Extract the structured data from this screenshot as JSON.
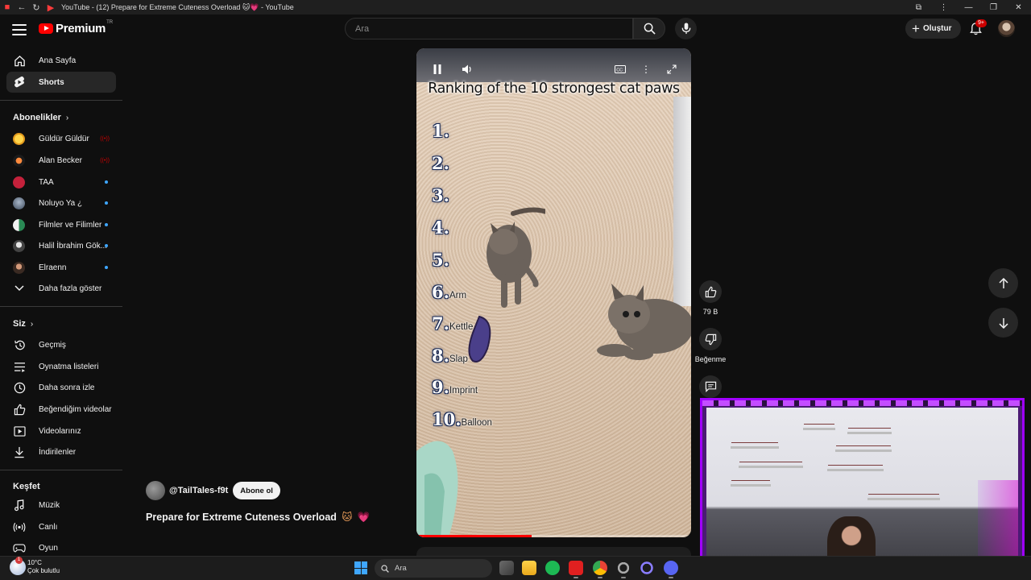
{
  "window": {
    "title": "YouTube - (12) Prepare for Extreme Cuteness Overload 🐱💗 - YouTube"
  },
  "masthead": {
    "logo_word": "Premium",
    "logo_sup": "TR",
    "search_placeholder": "Ara",
    "create_label": "Oluştur",
    "notification_count": "9+"
  },
  "sidebar": {
    "main": [
      {
        "label": "Ana Sayfa",
        "icon": "home-icon"
      },
      {
        "label": "Shorts",
        "icon": "shorts-icon",
        "active": true
      }
    ],
    "subscriptions_title": "Abonelikler",
    "subscriptions": [
      {
        "label": "Güldür Güldür",
        "indicator": "live"
      },
      {
        "label": "Alan Becker",
        "indicator": "live"
      },
      {
        "label": "TAA",
        "indicator": "new"
      },
      {
        "label": "Noluyo Ya ¿",
        "indicator": "new"
      },
      {
        "label": "Filmler ve Filimler",
        "indicator": "new"
      },
      {
        "label": "Halil İbrahim Gök...",
        "indicator": "new"
      },
      {
        "label": "Elraenn",
        "indicator": "new"
      }
    ],
    "show_more": "Daha fazla göster",
    "you_title": "Siz",
    "you_items": [
      {
        "label": "Geçmiş",
        "icon": "history-icon"
      },
      {
        "label": "Oynatma listeleri",
        "icon": "playlists-icon"
      },
      {
        "label": "Daha sonra izle",
        "icon": "watch-later-icon"
      },
      {
        "label": "Beğendiğim videolar",
        "icon": "liked-icon"
      },
      {
        "label": "Videolarınız",
        "icon": "your-videos-icon"
      },
      {
        "label": "İndirilenler",
        "icon": "downloads-icon"
      }
    ],
    "explore_title": "Keşfet",
    "explore_items": [
      {
        "label": "Müzik",
        "icon": "music-icon"
      },
      {
        "label": "Canlı",
        "icon": "live-icon"
      },
      {
        "label": "Oyun",
        "icon": "gaming-icon"
      }
    ]
  },
  "short": {
    "caption": "Ranking of the 10 strongest cat paws",
    "ranks": [
      {
        "num": "1.",
        "label": ""
      },
      {
        "num": "2.",
        "label": ""
      },
      {
        "num": "3.",
        "label": ""
      },
      {
        "num": "4.",
        "label": ""
      },
      {
        "num": "5.",
        "label": ""
      },
      {
        "num": "6.",
        "label": "Arm"
      },
      {
        "num": "7.",
        "label": "Kettle"
      },
      {
        "num": "8.",
        "label": "Slap"
      },
      {
        "num": "9.",
        "label": "Imprint"
      },
      {
        "num": "10.",
        "label": "Balloon"
      }
    ],
    "progress_fraction": 0.42,
    "channel": "@TailTales-f9t",
    "subscribe_label": "Abone ol",
    "title": "Prepare for Extreme Cuteness Overload",
    "title_emoji": "🐱",
    "title_heart": "💗"
  },
  "actions": {
    "like_count": "79 B",
    "dislike_label": "Beğenme"
  },
  "taskbar": {
    "temperature": "10°C",
    "weather": "Çok bulutlu",
    "search_placeholder": "Ara"
  },
  "colors": {
    "accent_red": "#ff0000",
    "webcam_frame": "#a100ff",
    "new_dot": "#3ea6ff"
  }
}
